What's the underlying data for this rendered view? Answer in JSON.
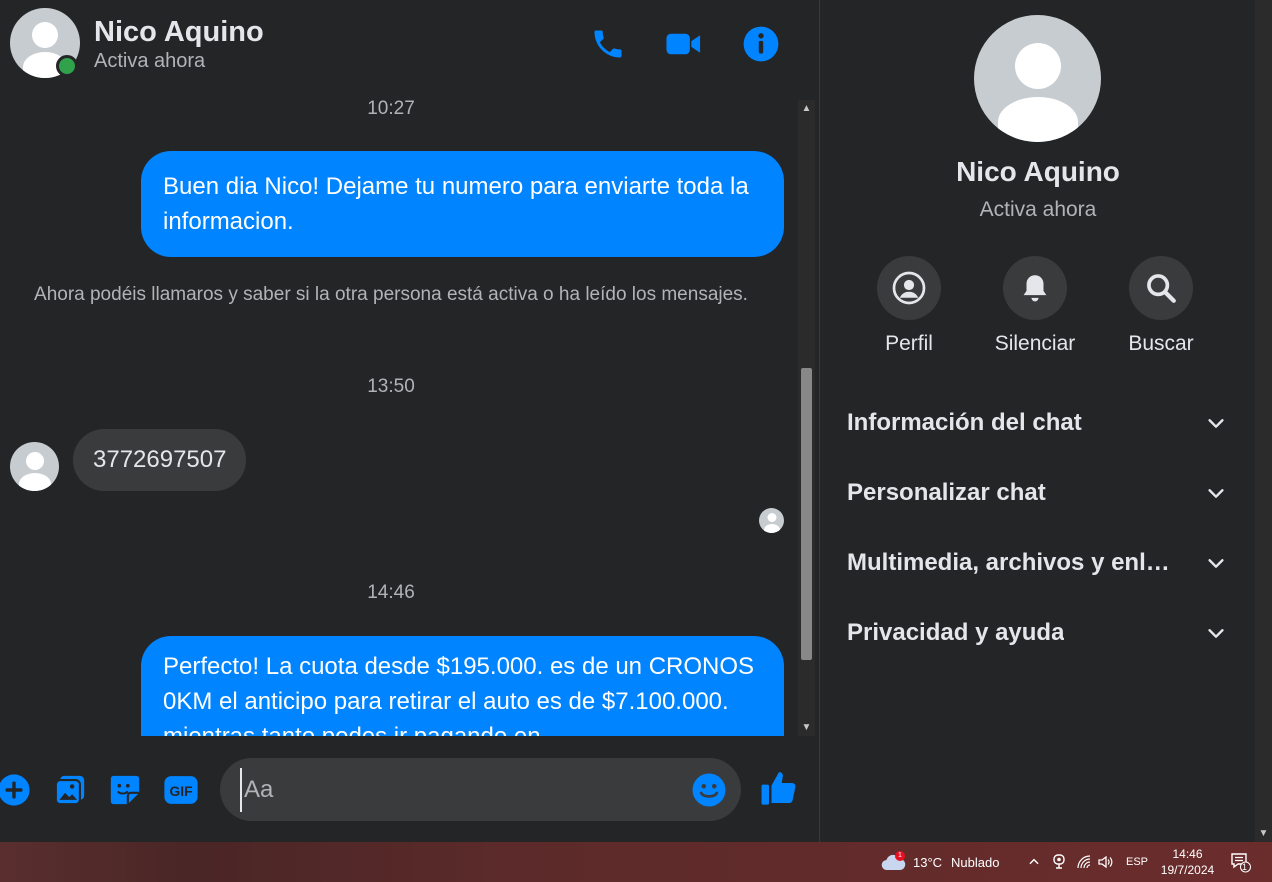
{
  "header": {
    "contact_name": "Nico Aquino",
    "status": "Activa ahora"
  },
  "messages": [
    {
      "type": "timestamp",
      "text": "10:27"
    },
    {
      "type": "outgoing",
      "text": "Buen dia Nico! Dejame tu numero para enviarte toda la informacion."
    },
    {
      "type": "system",
      "text": "Ahora podéis llamaros y saber si la otra persona está activa o ha leído los mensajes."
    },
    {
      "type": "timestamp",
      "text": "13:50"
    },
    {
      "type": "incoming",
      "text": "3772697507"
    },
    {
      "type": "timestamp",
      "text": "14:46"
    },
    {
      "type": "outgoing",
      "text": "Perfecto! La cuota desde $195.000. es de un CRONOS 0KM el anticipo para retirar el auto es de $7.100.000. mientras tanto podes ir pagando en"
    }
  ],
  "composer": {
    "placeholder": "Aa"
  },
  "info_panel": {
    "name": "Nico Aquino",
    "status": "Activa ahora",
    "actions": [
      {
        "label": "Perfil",
        "icon": "profile-icon"
      },
      {
        "label": "Silenciar",
        "icon": "bell-icon"
      },
      {
        "label": "Buscar",
        "icon": "search-icon"
      }
    ],
    "sections": [
      {
        "title": "Información del chat"
      },
      {
        "title": "Personalizar chat"
      },
      {
        "title": "Multimedia, archivos y enlaces"
      },
      {
        "title": "Privacidad y ayuda"
      }
    ]
  },
  "taskbar": {
    "weather_badge": "1",
    "temperature": "13°C",
    "weather": "Nublado",
    "language": "ESP",
    "time": "14:46",
    "date": "19/7/2024",
    "notification_count": "1"
  },
  "colors": {
    "accent": "#0084ff",
    "background": "#242526",
    "bubble_in": "#3a3b3c",
    "online": "#31a24c"
  }
}
